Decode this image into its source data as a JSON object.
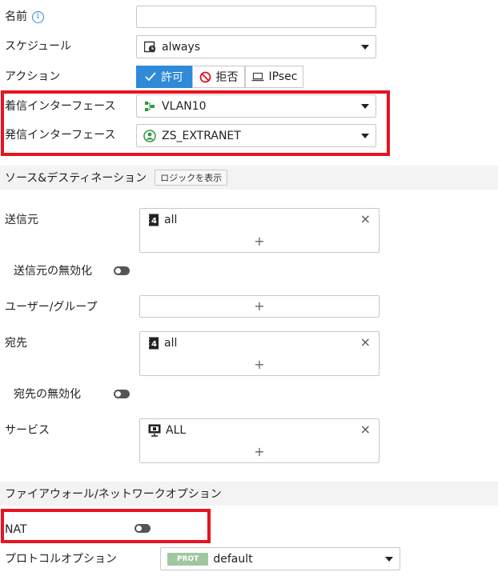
{
  "fields": {
    "name_label": "名前",
    "schedule_label": "スケジュール",
    "schedule_value": "always",
    "action_label": "アクション",
    "action_allow": "許可",
    "action_deny": "拒否",
    "action_ipsec": "IPsec",
    "incoming_label": "着信インターフェース",
    "incoming_value": "VLAN10",
    "outgoing_label": "発信インターフェース",
    "outgoing_value": "ZS_EXTRANET"
  },
  "source_dest": {
    "section_title": "ソース&デスティネーション",
    "logic_button": "ロジックを表示",
    "source_label": "送信元",
    "source_value": "all",
    "negate_source_label": "送信元の無効化",
    "user_group_label": "ユーザー/グループ",
    "destination_label": "宛先",
    "destination_value": "all",
    "negate_destination_label": "宛先の無効化",
    "service_label": "サービス",
    "service_value": "ALL",
    "plus": "+",
    "remove": "×"
  },
  "firewall": {
    "section_title": "ファイアウォール/ネットワークオプション",
    "nat_label": "NAT",
    "protocol_label": "プロトコルオプション",
    "protocol_badge": "PROT",
    "protocol_value": "default"
  },
  "colors": {
    "accent": "#2f8ad8",
    "highlight": "#e8121f",
    "toggle_off": "#555555",
    "prot_badge": "#9fc89f"
  },
  "icons": {
    "info": "info-icon",
    "schedule": "calendar-clock-icon",
    "allow": "check-icon",
    "deny": "prohibit-icon",
    "ipsec": "laptop-icon",
    "vlan": "network-port-icon",
    "zone": "zone-icon",
    "address": "address-object-icon",
    "service": "service-icon"
  }
}
